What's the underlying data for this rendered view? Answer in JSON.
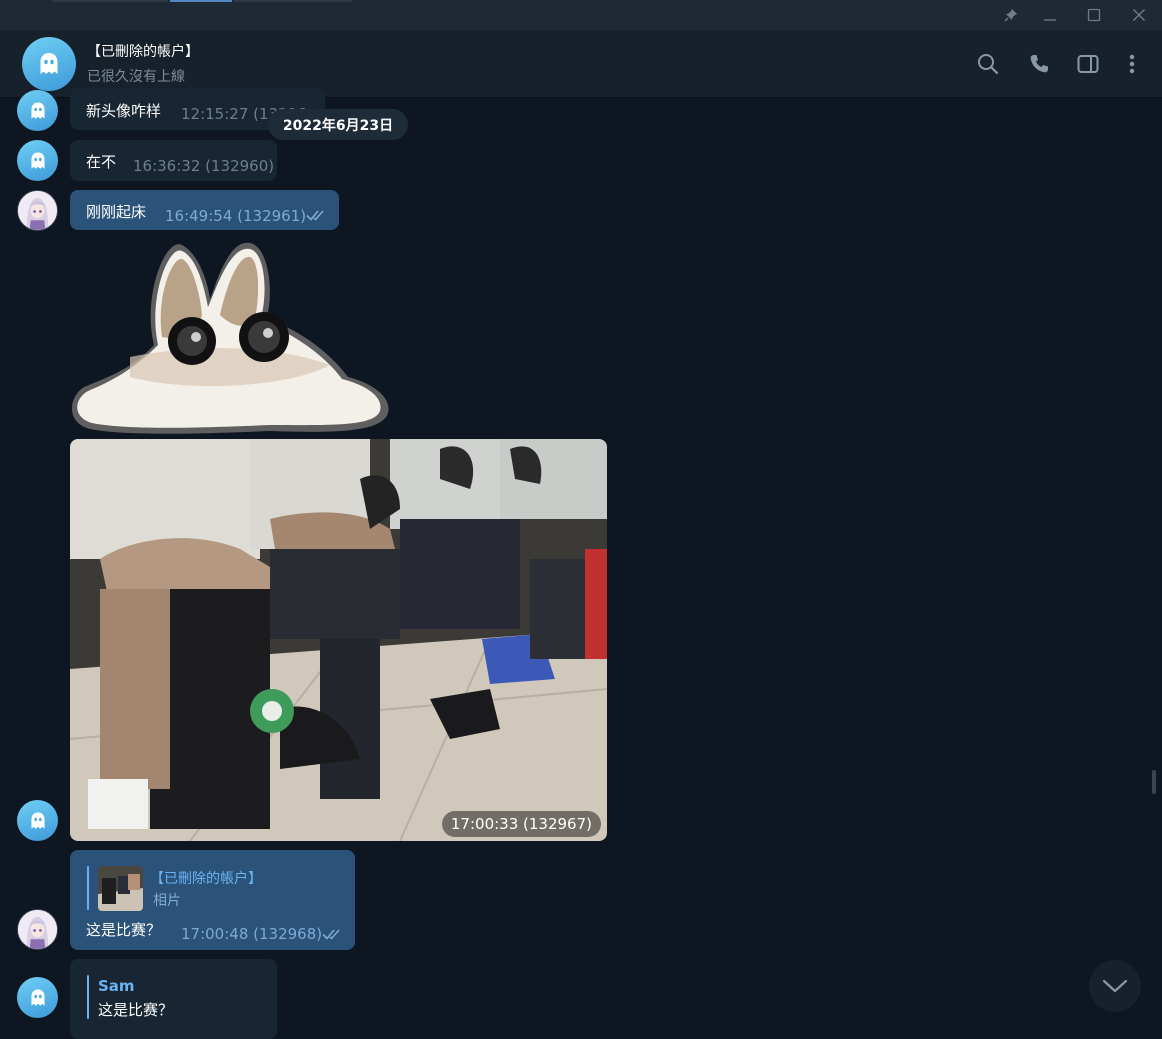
{
  "header": {
    "name": "【已刪除的帳户】",
    "status": "已很久沒有上線"
  },
  "date_separator": "2022年6月23日",
  "messages": [
    {
      "text": "新头像咋样",
      "time": "12:15:27 (13296"
    },
    {
      "text": "在不",
      "time": "16:36:32 (132960)"
    },
    {
      "text": "刚刚起床",
      "time": "16:49:54 (132961)"
    },
    {
      "photo_time": "17:00:33 (132967)"
    },
    {
      "reply_name": "【已刪除的帳户】",
      "reply_text": "相片",
      "text": "这是比赛？",
      "time": "17:00:48 (132968)"
    },
    {
      "reply_name": "Sam",
      "reply_text": "这是比赛？"
    }
  ],
  "icons": [
    "pin-icon",
    "minimize-icon",
    "maximize-icon",
    "close-icon",
    "search-icon",
    "phone-icon",
    "sidebar-toggle-icon",
    "more-vertical-icon",
    "ghost-icon",
    "double-check-icon",
    "chevron-down-icon"
  ],
  "colors": {
    "background": "#0e1621",
    "incoming": "#182533",
    "outgoing": "#2b5278",
    "accent": "#6ab2f2"
  }
}
